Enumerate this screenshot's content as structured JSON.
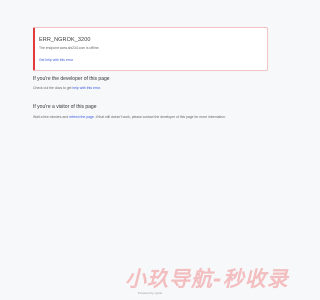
{
  "error": {
    "code": "ERR_NGROK_3200",
    "description": "The endpoint www.shi234.com is offline.",
    "help_link": "Get help with this error"
  },
  "developer": {
    "heading": "If you're the developer of this page",
    "text_before": "Check out the docs to get ",
    "link": "help with this error",
    "text_after": "."
  },
  "visitor": {
    "heading": "If you're a visitor of this page",
    "text_before": "Wait a few minutes and ",
    "link": "refresh the page",
    "text_after": ". If that still doesn't work, please contact the developer of this page for more information."
  },
  "watermark": "小玖导航-秒收录",
  "footer": "Powered by ngrok",
  "colors": {
    "error_accent": "#e23b3b",
    "link": "#3b5bdb",
    "background": "#f7f8fa"
  }
}
